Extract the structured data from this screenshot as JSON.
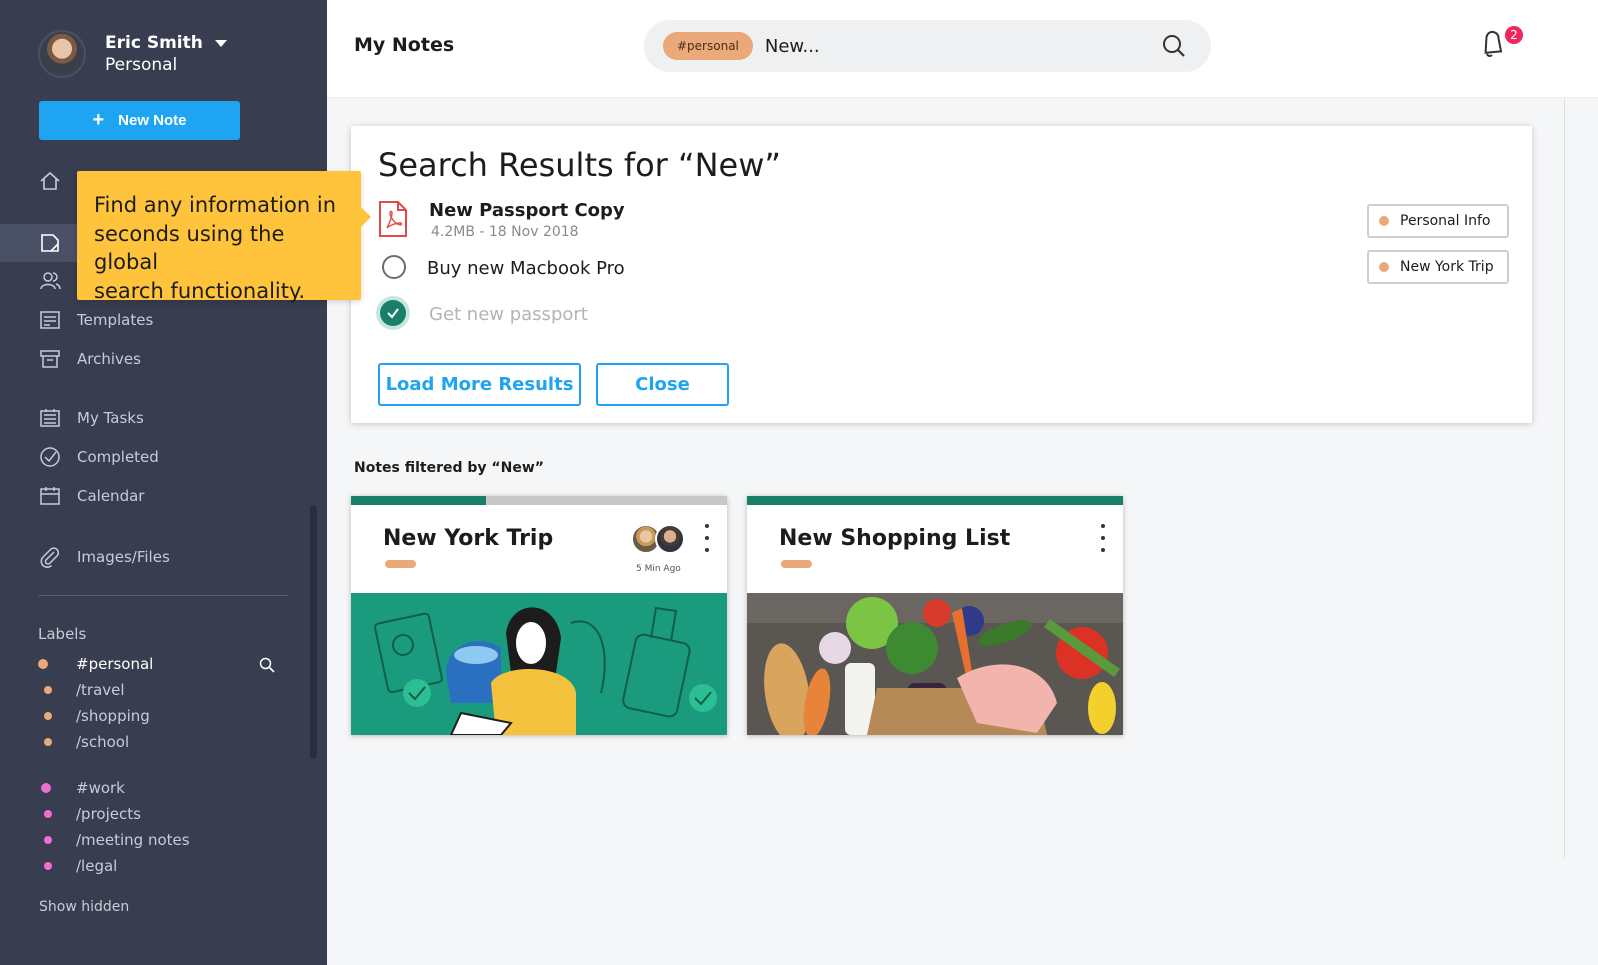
{
  "user": {
    "name": "Eric Smith",
    "workspace": "Personal"
  },
  "new_note_label": "New Note",
  "nav": {
    "templates": "Templates",
    "archives": "Archives",
    "my_tasks": "My Tasks",
    "completed": "Completed",
    "calendar": "Calendar",
    "images_files": "Images/Files"
  },
  "labels": {
    "title": "Labels",
    "items": [
      {
        "text": "#personal",
        "color": "#eba979"
      },
      {
        "text": "/travel",
        "color": "#eba979"
      },
      {
        "text": "/shopping",
        "color": "#eba979"
      },
      {
        "text": "/school",
        "color": "#eba979"
      },
      {
        "text": "#work",
        "color": "#ef6fce"
      },
      {
        "text": "/projects",
        "color": "#ef6fce"
      },
      {
        "text": "/meeting notes",
        "color": "#ef6fce"
      },
      {
        "text": "/legal",
        "color": "#ef6fce"
      }
    ],
    "show_hidden": "Show hidden"
  },
  "tooltip": {
    "line1": "Find any information in",
    "line2": "seconds using the global",
    "line3": "search functionality."
  },
  "header": {
    "title": "My Notes",
    "search_chip": "#personal",
    "search_value": "New...",
    "notification_count": "2"
  },
  "results": {
    "title": "Search Results for  “New”",
    "file_name": "New Passport Copy",
    "file_meta": "4.2MB - 18 Nov 2018",
    "task_open": "Buy new Macbook Pro",
    "task_done": "Get new passport",
    "load_more": "Load More Results",
    "close": "Close",
    "tags": [
      "Personal Info",
      "New York Trip"
    ]
  },
  "filtered": {
    "title": "Notes filtered by “New”",
    "cards": [
      {
        "title": "New York Trip",
        "time": "5 Min Ago",
        "progress": 0.36
      },
      {
        "title": "New Shopping List",
        "progress": 1.0
      }
    ]
  },
  "colors": {
    "sidebar": "#383d4f",
    "accent": "#1ea4f0",
    "tooltip": "#ffc43b",
    "progress": "#1a7f68",
    "personal_label": "#eba979",
    "work_label": "#ef6fce",
    "badge": "#f0275a"
  }
}
